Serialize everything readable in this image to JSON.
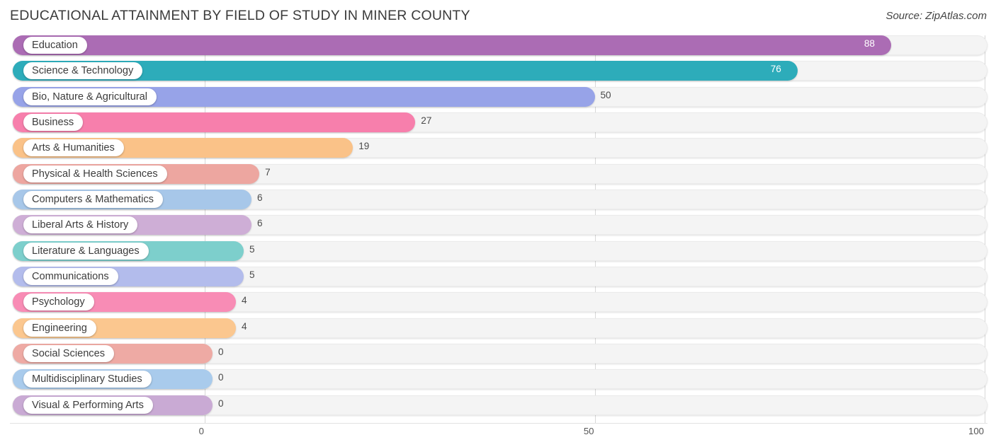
{
  "header": {
    "title": "EDUCATIONAL ATTAINMENT BY FIELD OF STUDY IN MINER COUNTY",
    "source": "Source: ZipAtlas.com"
  },
  "chart_data": {
    "type": "bar",
    "orientation": "horizontal",
    "title": "EDUCATIONAL ATTAINMENT BY FIELD OF STUDY IN MINER COUNTY",
    "xlabel": "",
    "ylabel": "",
    "xlim": [
      0,
      100
    ],
    "xticks": [
      "0",
      "50",
      "100"
    ],
    "grid": true,
    "legend": false,
    "categories": [
      "Education",
      "Science & Technology",
      "Bio, Nature & Agricultural",
      "Business",
      "Arts & Humanities",
      "Physical & Health Sciences",
      "Computers & Mathematics",
      "Liberal Arts & History",
      "Literature & Languages",
      "Communications",
      "Psychology",
      "Engineering",
      "Social Sciences",
      "Multidisciplinary Studies",
      "Visual & Performing Arts"
    ],
    "values": [
      88,
      76,
      50,
      27,
      19,
      7,
      6,
      6,
      5,
      5,
      4,
      4,
      0,
      0,
      0
    ],
    "colors": [
      "#ab6cb4",
      "#2dacba",
      "#97a3e8",
      "#f77fac",
      "#fac288",
      "#eda6a0",
      "#a7c7e9",
      "#ceaed6",
      "#7dcfcc",
      "#b3bcec",
      "#f88cb5",
      "#fbc78f",
      "#eeaaa4",
      "#a9cbec",
      "#c9aad4"
    ],
    "value_labels": [
      "88",
      "76",
      "50",
      "27",
      "19",
      "7",
      "6",
      "6",
      "5",
      "5",
      "4",
      "4",
      "0",
      "0",
      "0"
    ],
    "value_label_inside": [
      true,
      true,
      false,
      false,
      false,
      false,
      false,
      false,
      false,
      false,
      false,
      false,
      false,
      false,
      false
    ]
  }
}
